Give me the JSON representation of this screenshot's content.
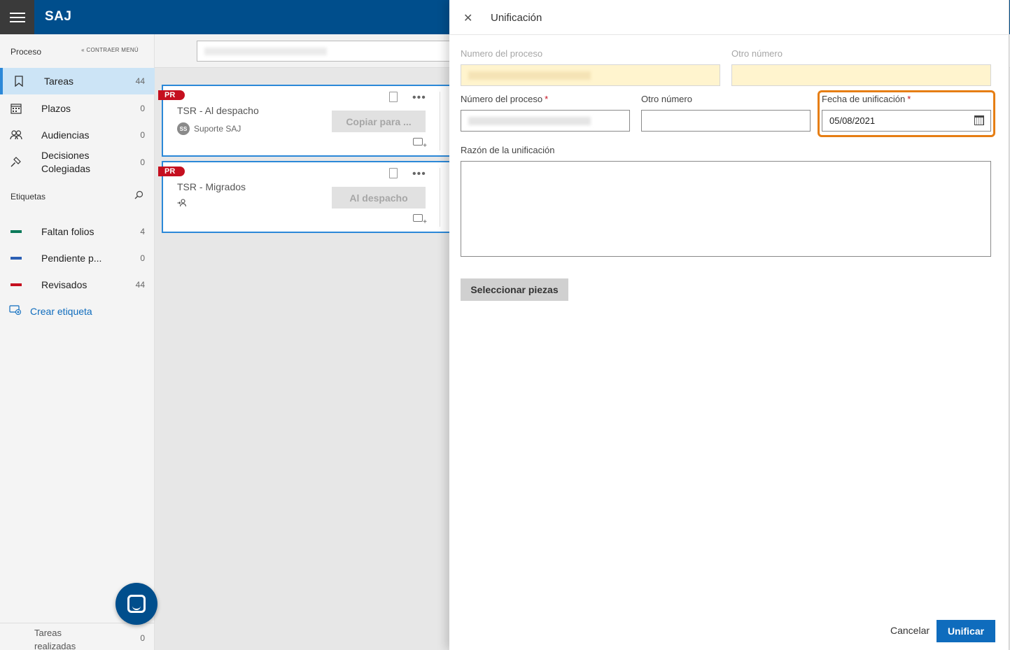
{
  "app": {
    "title": "SAJ"
  },
  "sidebar": {
    "header": "Proceso",
    "collapse_label": "« CONTRAER MENÚ",
    "items": [
      {
        "label": "Tareas",
        "count": "44",
        "icon": "bookmark-icon"
      },
      {
        "label": "Plazos",
        "count": "0",
        "icon": "calendar-icon"
      },
      {
        "label": "Audiencias",
        "count": "0",
        "icon": "people-icon"
      },
      {
        "label": "Decisiones Colegiadas",
        "count": "0",
        "icon": "gavel-icon"
      }
    ],
    "tags_header": "Etiquetas",
    "tags": [
      {
        "label": "Faltan folios",
        "count": "4",
        "color": "#0b7a5a"
      },
      {
        "label": "Pendiente p...",
        "count": "0",
        "color": "#2b5fb4"
      },
      {
        "label": "Revisados",
        "count": "44",
        "color": "#c50f1f"
      }
    ],
    "create_tag": "Crear etiqueta",
    "footer": {
      "label": "Tareas realizadas",
      "count": "0"
    }
  },
  "cards": [
    {
      "badge": "PR",
      "title": "TSR - Al despacho",
      "avatar": "SS",
      "user": "Suporte SAJ",
      "action": "Copiar para ..."
    },
    {
      "badge": "PR",
      "title": "TSR - Migrados",
      "action": "Al despacho"
    }
  ],
  "panel": {
    "title": "Unificación",
    "top_labels": {
      "numero": "Numero del proceso",
      "otro": "Otro número"
    },
    "form": {
      "numero_label": "Número del proceso",
      "otro_label": "Otro número",
      "fecha_label": "Fecha de unificación",
      "fecha_value": "05/08/2021",
      "razon_label": "Razón de la unificación",
      "required_mark": "*"
    },
    "select_button": "Seleccionar piezas",
    "cancel": "Cancelar",
    "submit": "Unificar"
  }
}
